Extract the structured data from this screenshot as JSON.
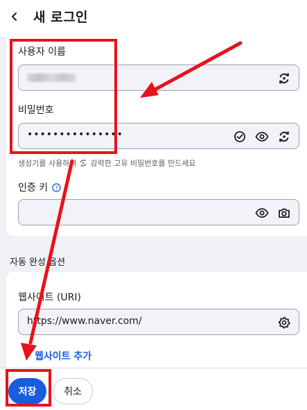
{
  "header": {
    "title": "새 로그인",
    "back_icon": "chevron-left-icon"
  },
  "login": {
    "username_label": "사용자 이름",
    "username_value_blurred": true,
    "password_label": "비밀번호",
    "password_value": "•••••••••••••••",
    "password_helper_prefix": "생성기를 사용하여",
    "password_helper_suffix": "강력한 고유 비밀번호를 만드세요",
    "totp_label": "인증 키",
    "totp_value": ""
  },
  "autofill": {
    "section_title": "자동 완성 옵션",
    "uri_label": "웹사이트 (URI)",
    "uri_value": "https://www.naver.com/",
    "add_website_label": "웹사이트 추가"
  },
  "footer": {
    "save_label": "저장",
    "cancel_label": "취소"
  },
  "colors": {
    "accent": "#175ddc",
    "annotation": "#e8121b"
  }
}
